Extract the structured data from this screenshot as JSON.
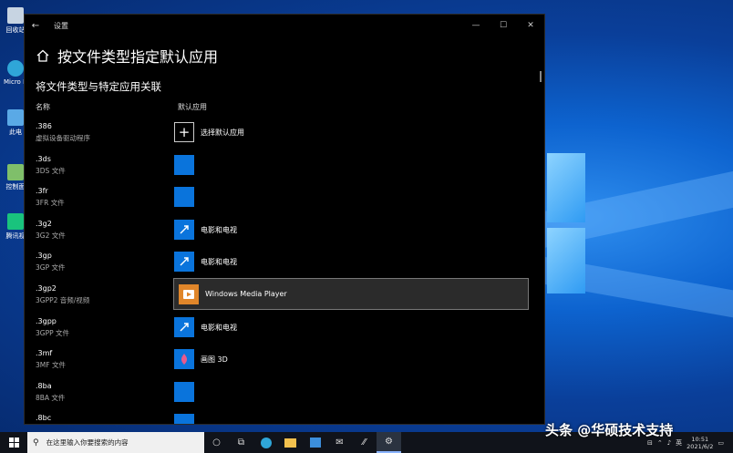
{
  "desktop": {
    "icons": [
      {
        "label": "回收站",
        "color": "#c7d4e2"
      },
      {
        "label": "Micro Edg",
        "color": "#2fa6d8"
      },
      {
        "label": "此电",
        "color": "#5aa9e6"
      },
      {
        "label": "控制面",
        "color": "#7fbf6a"
      },
      {
        "label": "腾讯视",
        "color": "#19c37d"
      }
    ]
  },
  "window": {
    "title": "设置",
    "controls": {
      "minimize": "—",
      "maximize": "☐",
      "close": "✕"
    },
    "back_glyph": "←",
    "page_title": "按文件类型指定默认应用",
    "subtitle": "将文件类型与特定应用关联",
    "col_name": "名称",
    "col_default": "默认应用",
    "rows": [
      {
        "ext": ".386",
        "desc": "虚拟设备驱动程序",
        "app": "选择默认应用",
        "icon": "plus"
      },
      {
        "ext": ".3ds",
        "desc": "3DS 文件",
        "app": "",
        "icon": "blank"
      },
      {
        "ext": ".3fr",
        "desc": "3FR 文件",
        "app": "",
        "icon": "blank"
      },
      {
        "ext": ".3g2",
        "desc": "3G2 文件",
        "app": "电影和电视",
        "icon": "movies"
      },
      {
        "ext": ".3gp",
        "desc": "3GP 文件",
        "app": "电影和电视",
        "icon": "movies"
      },
      {
        "ext": ".3gp2",
        "desc": "3GPP2 音频/视频",
        "app": "Windows Media Player",
        "icon": "wmp"
      },
      {
        "ext": ".3gpp",
        "desc": "3GPP 文件",
        "app": "电影和电视",
        "icon": "movies"
      },
      {
        "ext": ".3mf",
        "desc": "3MF 文件",
        "app": "画图 3D",
        "icon": "paint3d"
      },
      {
        "ext": ".8ba",
        "desc": "8BA 文件",
        "app": "",
        "icon": "blank"
      },
      {
        "ext": ".8bc",
        "desc": "",
        "app": "",
        "icon": "blank"
      }
    ]
  },
  "taskbar": {
    "search_placeholder": "在这里输入你要搜索的内容",
    "ime": "英",
    "time": "10:51",
    "date": "2021/6/2"
  },
  "watermark": "头条 @华硕技术支持",
  "colors": {
    "tile": "#0a74dc",
    "window_bg": "#000000",
    "selected_row": "#2b2b2b"
  }
}
